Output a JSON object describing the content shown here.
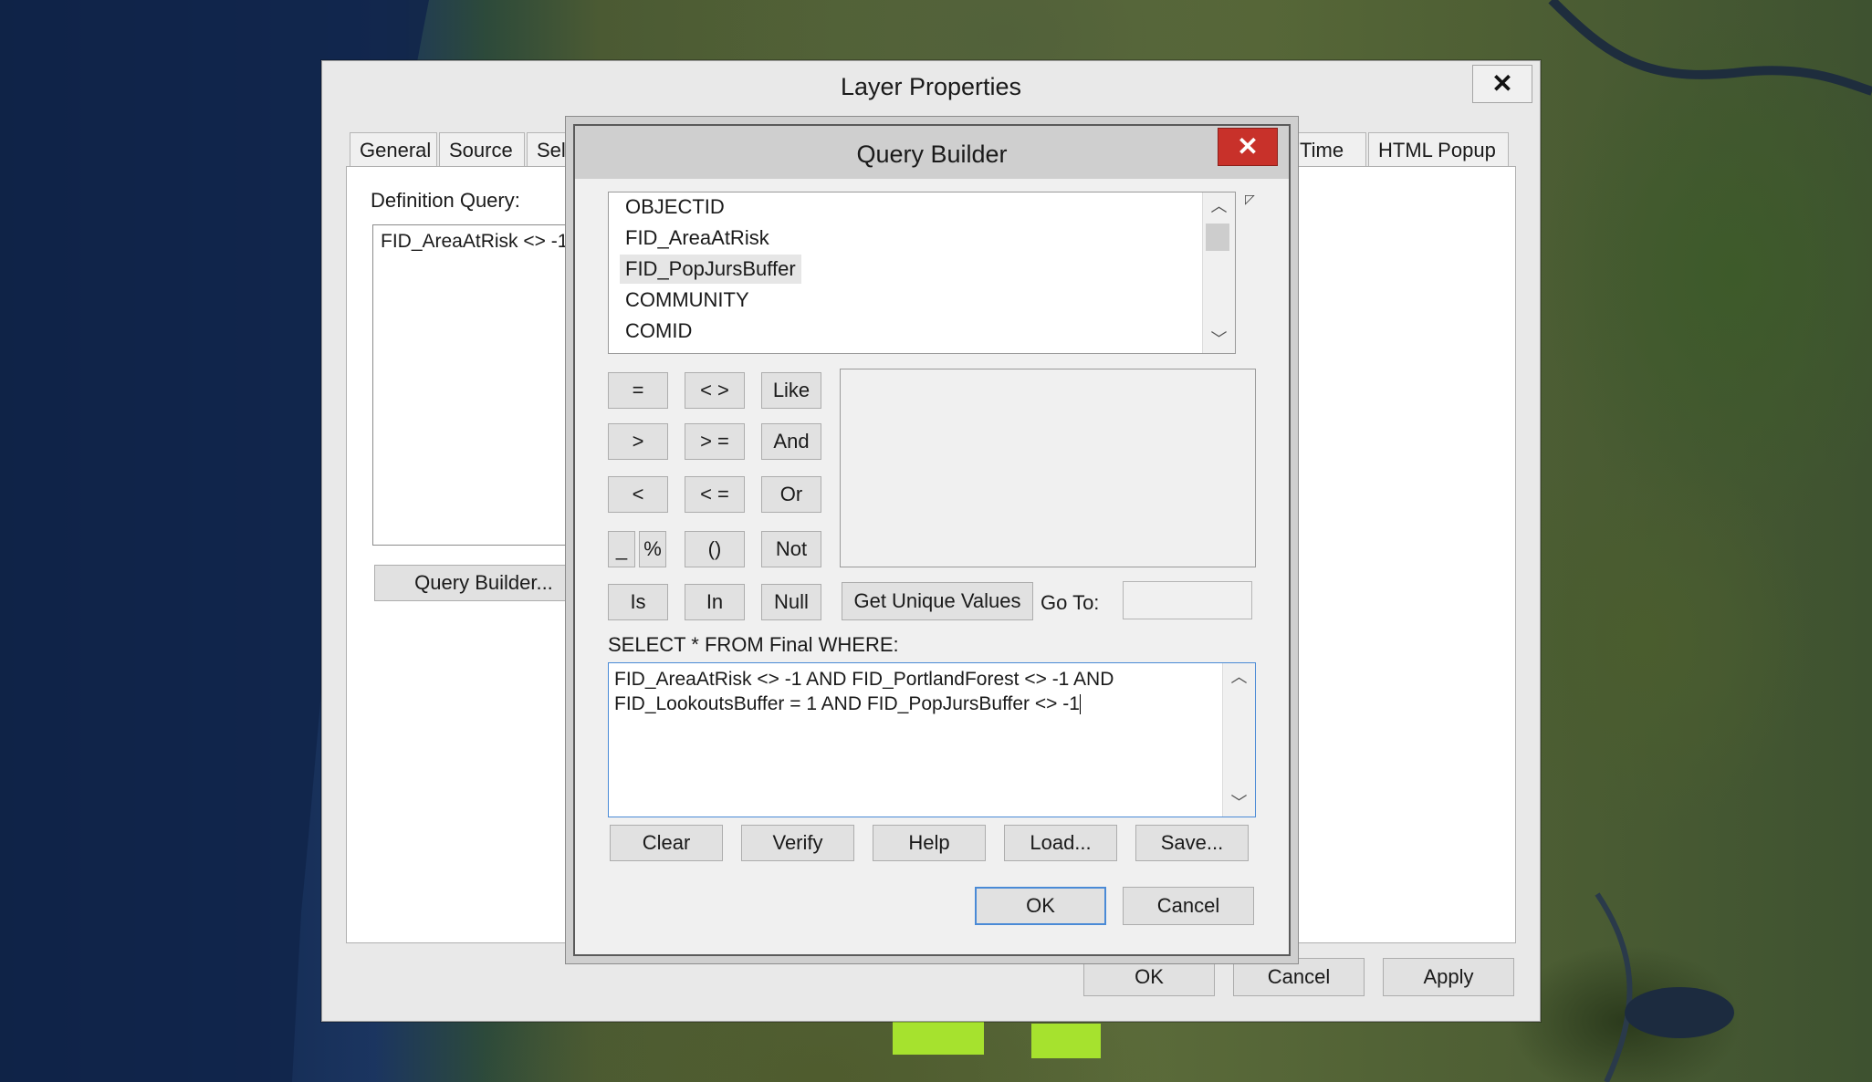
{
  "layer_properties": {
    "title": "Layer Properties",
    "close": "✕",
    "tabs": [
      "General",
      "Source",
      "Sele",
      "Time",
      "HTML Popup"
    ],
    "definition_query_label": "Definition Query:",
    "definition_query_value": "FID_AreaAtRisk <> -1",
    "query_builder_button": "Query Builder...",
    "ok": "OK",
    "cancel": "Cancel",
    "apply": "Apply"
  },
  "query_builder": {
    "title": "Query Builder",
    "close": "✕",
    "fields": [
      "OBJECTID",
      "FID_AreaAtRisk",
      "FID_PopJursBuffer",
      "COMMUNITY",
      "COMID"
    ],
    "selected_field": "FID_PopJursBuffer",
    "operators": {
      "eq": "=",
      "ne": "< >",
      "like": "Like",
      "gt": ">",
      "ge": "> =",
      "and": "And",
      "lt": "<",
      "le": "< =",
      "or": "Or",
      "underscore": "_",
      "percent": "%",
      "parens": "()",
      "not": "Not",
      "is": "Is",
      "in": "In",
      "null": "Null"
    },
    "get_unique_values": "Get Unique Values",
    "goto_label": "Go To:",
    "goto_value": "",
    "where_label": "SELECT * FROM Final WHERE:",
    "where_clause": "FID_AreaAtRisk <> -1 AND FID_PortlandForest <> -1 AND\nFID_LookoutsBuffer = 1 AND FID_PopJursBuffer <> -1",
    "clear": "Clear",
    "verify": "Verify",
    "help": "Help",
    "load": "Load...",
    "save": "Save...",
    "ok": "OK",
    "cancel": "Cancel"
  }
}
